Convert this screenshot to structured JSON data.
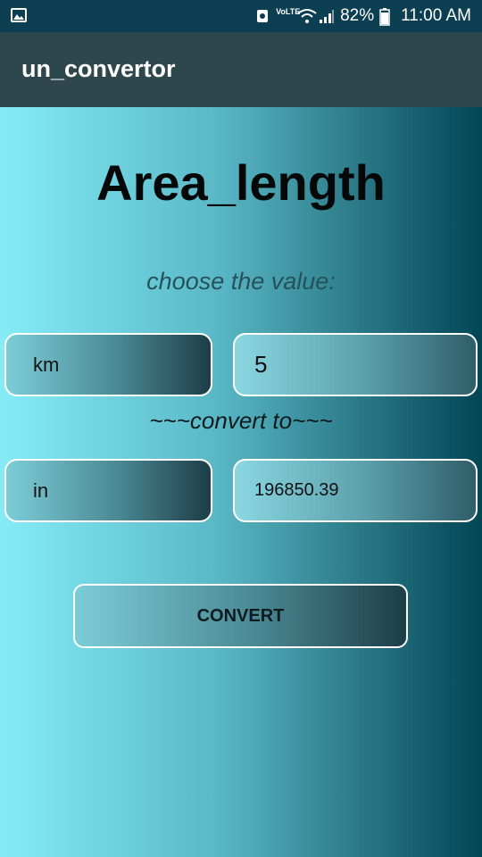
{
  "status_bar": {
    "battery": "82%",
    "time": "11:00 AM",
    "volte": "VoLTE",
    "icons": [
      "image-icon",
      "sync-icon",
      "wifi-icon",
      "signal-icon",
      "battery-icon"
    ]
  },
  "app_bar": {
    "title": "un_convertor"
  },
  "main": {
    "heading": "Area_length",
    "prompt": "choose the value:",
    "from_unit": "km",
    "from_value": "5",
    "convert_to": "~~~convert to~~~",
    "to_unit": "in",
    "to_value": "196850.39",
    "convert_button": "CONVERT"
  },
  "colors": {
    "status_bar": "#0d3f52",
    "app_bar": "#2e474d",
    "gradient_start": "#85ecf7",
    "gradient_end": "#024655"
  }
}
